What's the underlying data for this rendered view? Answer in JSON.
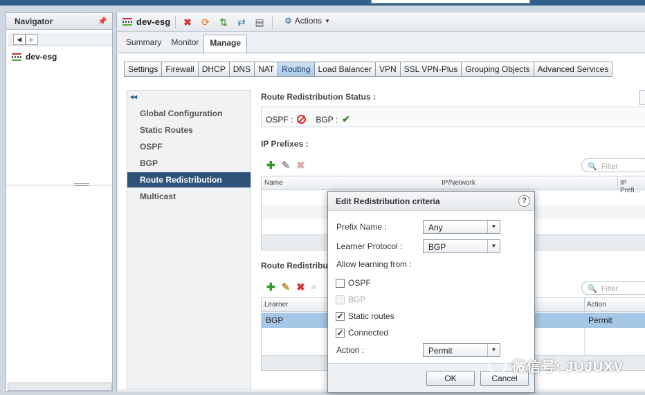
{
  "navigator": {
    "title": "Navigator",
    "back_glyph": "◀",
    "forward_glyph": "▶",
    "tree": [
      {
        "label": "dev-esg",
        "icon": "edge-gateway-icon"
      }
    ]
  },
  "header": {
    "object_name": "dev-esg",
    "actions_label": "Actions",
    "toolbar_icons": [
      "delete-icon",
      "refresh-icon",
      "migrate-icon",
      "sync-icon",
      "notes-icon"
    ]
  },
  "subtabs": [
    "Summary",
    "Monitor",
    "Manage"
  ],
  "subtab_active": "Manage",
  "section_tabs": [
    "Settings",
    "Firewall",
    "DHCP",
    "DNS",
    "NAT",
    "Routing",
    "Load Balancer",
    "VPN",
    "SSL VPN-Plus",
    "Grouping Objects",
    "Advanced Services"
  ],
  "section_tab_active": "Routing",
  "routing_menu": {
    "collapse_glyph": "◂◂",
    "items": [
      "Global Configuration",
      "Static Routes",
      "OSPF",
      "BGP",
      "Route Redistribution",
      "Multicast"
    ],
    "active": "Route Redistribution"
  },
  "redistribution_status": {
    "title": "Route Redistribution Status :",
    "ospf_label": "OSPF :",
    "ospf_state": "disabled",
    "bgp_label": "BGP :",
    "bgp_state": "enabled"
  },
  "ip_prefixes": {
    "title": "IP Prefixes :",
    "filter_placeholder": "Filter",
    "columns": [
      "Name",
      "IP/Network",
      "IP Prefi..."
    ]
  },
  "redistribution_table": {
    "title": "Route Redistributi",
    "filter_placeholder": "Filter",
    "columns": [
      "Learner",
      "Action"
    ],
    "rows": [
      {
        "learner": "BGP",
        "action": "Permit"
      }
    ]
  },
  "dialog": {
    "title": "Edit Redistribution criteria",
    "help": "?",
    "prefix_name_label": "Prefix Name :",
    "prefix_name_value": "Any",
    "learner_protocol_label": "Learner Protocol :",
    "learner_protocol_value": "BGP",
    "allow_learning_label": "Allow learning from :",
    "options": [
      {
        "label": "OSPF",
        "checked": false,
        "disabled": false
      },
      {
        "label": "BGP",
        "checked": false,
        "disabled": true
      },
      {
        "label": "Static routes",
        "checked": true,
        "disabled": false
      },
      {
        "label": "Connected",
        "checked": true,
        "disabled": false
      }
    ],
    "action_label": "Action :",
    "action_value": "Permit",
    "ok_label": "OK",
    "cancel_label": "Cancel"
  },
  "watermark": "微信号: JUJUXV"
}
